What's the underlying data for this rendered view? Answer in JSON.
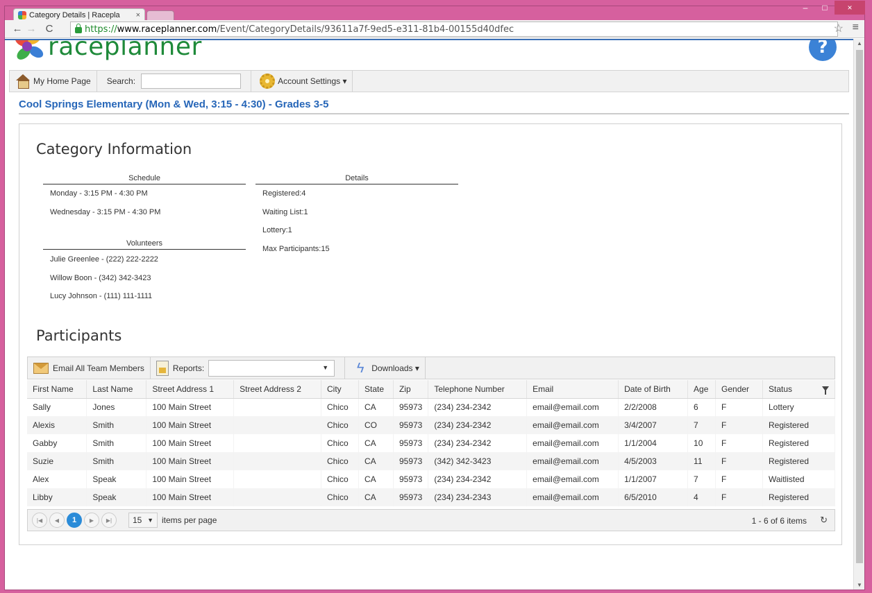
{
  "browser": {
    "tab_title": "Category Details | Racepla",
    "tab_close": "×",
    "url_scheme": "https://",
    "url_host": "www.raceplanner.com",
    "url_path": "/Event/CategoryDetails/93611a7f-9ed5-e311-81b4-00155d40dfec",
    "window_controls": {
      "minimize": "–",
      "maximize": "□",
      "close": "×"
    }
  },
  "brand": {
    "name": "raceplanner",
    "help": "?"
  },
  "nav": {
    "home_label": "My Home Page",
    "search_label": "Search:",
    "search_value": "",
    "account_label": "Account Settings ▾"
  },
  "page_title": "Cool Springs Elementary (Mon & Wed, 3:15 - 4:30) - Grades 3-5",
  "category_info": {
    "heading": "Category Information",
    "schedule": {
      "heading": "Schedule",
      "items": [
        "Monday - 3:15 PM - 4:30 PM",
        "Wednesday - 3:15 PM - 4:30 PM"
      ]
    },
    "details": {
      "heading": "Details",
      "items": [
        "Registered:4",
        "Waiting List:1",
        "Lottery:1",
        "Max Participants:15"
      ]
    },
    "volunteers": {
      "heading": "Volunteers",
      "items": [
        "Julie Greenlee - (222) 222-2222",
        "Willow Boon - (342) 342-3423",
        "Lucy Johnson - (111) 111-1111"
      ]
    }
  },
  "participants": {
    "heading": "Participants",
    "toolbar": {
      "email_label": "Email All Team Members",
      "reports_label": "Reports:",
      "reports_value": "",
      "downloads_label": "Downloads ▾"
    },
    "columns": [
      "First Name",
      "Last Name",
      "Street Address 1",
      "Street Address 2",
      "City",
      "State",
      "Zip",
      "Telephone Number",
      "Email",
      "Date of Birth",
      "Age",
      "Gender",
      "Status"
    ],
    "rows": [
      [
        "Sally",
        "Jones",
        "100 Main Street",
        "",
        "Chico",
        "CA",
        "95973",
        "(234) 234-2342",
        "email@email.com",
        "2/2/2008",
        "6",
        "F",
        "Lottery"
      ],
      [
        "Alexis",
        "Smith",
        "100 Main Street",
        "",
        "Chico",
        "CO",
        "95973",
        "(234) 234-2342",
        "email@email.com",
        "3/4/2007",
        "7",
        "F",
        "Registered"
      ],
      [
        "Gabby",
        "Smith",
        "100 Main Street",
        "",
        "Chico",
        "CA",
        "95973",
        "(234) 234-2342",
        "email@email.com",
        "1/1/2004",
        "10",
        "F",
        "Registered"
      ],
      [
        "Suzie",
        "Smith",
        "100 Main Street",
        "",
        "Chico",
        "CA",
        "95973",
        "(342) 342-3423",
        "email@email.com",
        "4/5/2003",
        "11",
        "F",
        "Registered"
      ],
      [
        "Alex",
        "Speak",
        "100 Main Street",
        "",
        "Chico",
        "CA",
        "95973",
        "(234) 234-2342",
        "email@email.com",
        "1/1/2007",
        "7",
        "F",
        "Waitlisted"
      ],
      [
        "Libby",
        "Speak",
        "100 Main Street",
        "",
        "Chico",
        "CA",
        "95973",
        "(234) 234-2343",
        "email@email.com",
        "6/5/2010",
        "4",
        "F",
        "Registered"
      ]
    ],
    "pager": {
      "current_page": "1",
      "page_size": "15",
      "items_per_page_label": "items per page",
      "info": "1 - 6 of 6 items"
    }
  }
}
